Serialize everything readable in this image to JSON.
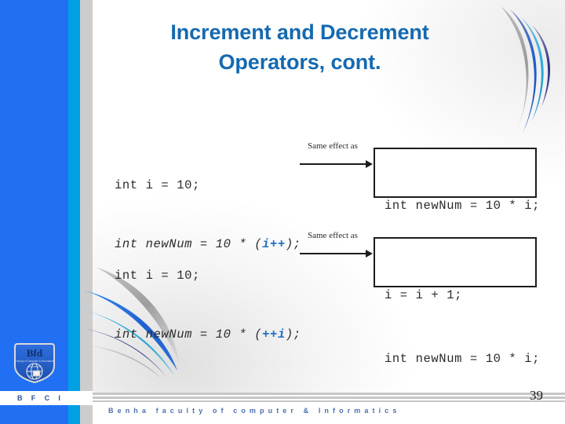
{
  "slide": {
    "title_line1": "Increment and Decrement",
    "title_line2": "Operators, cont.",
    "page_number": "39",
    "title_color": "#1569b0",
    "accent_blue": "#2170f4",
    "accent_cyan": "#00a0e4",
    "accent_gray": "#cdcdcd",
    "highlight_color": "#1f6fc4"
  },
  "examples": [
    {
      "id": "postfix",
      "code_line1": "int i = 10;",
      "code_line2_prefix": "int newNum = 10 * (",
      "code_line2_highlight": "i++",
      "code_line2_suffix": ");",
      "arrow_label": "Same effect as",
      "result_line1": "int newNum = 10 * i;",
      "result_line2": "i = i + 1;"
    },
    {
      "id": "prefix",
      "code_line1": "int i = 10;",
      "code_line2_prefix": "int newNum = 10 * (",
      "code_line2_highlight": "++i",
      "code_line2_suffix": ");",
      "arrow_label": "Same effect as",
      "result_line1": "i = i + 1;",
      "result_line2": "int newNum = 10 * i;"
    }
  ],
  "footer": {
    "institution": "Benha faculty of computer & Informatics",
    "logo_abbreviation": "B F C I",
    "logo_mark_text": "Bfd"
  }
}
